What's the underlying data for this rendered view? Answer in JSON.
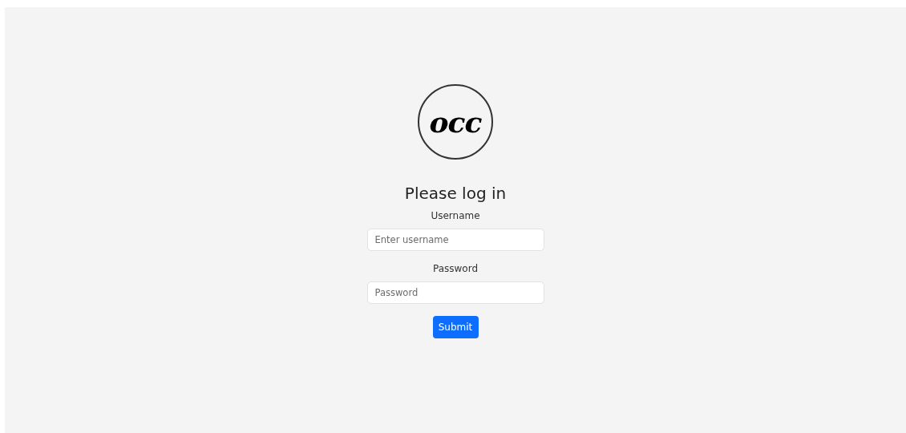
{
  "logo": {
    "text": "occ"
  },
  "title": "Please log in",
  "fields": [
    {
      "label": "Username",
      "placeholder": "Enter username"
    },
    {
      "label": "Password",
      "placeholder": "Password"
    }
  ],
  "submit": "Submit"
}
